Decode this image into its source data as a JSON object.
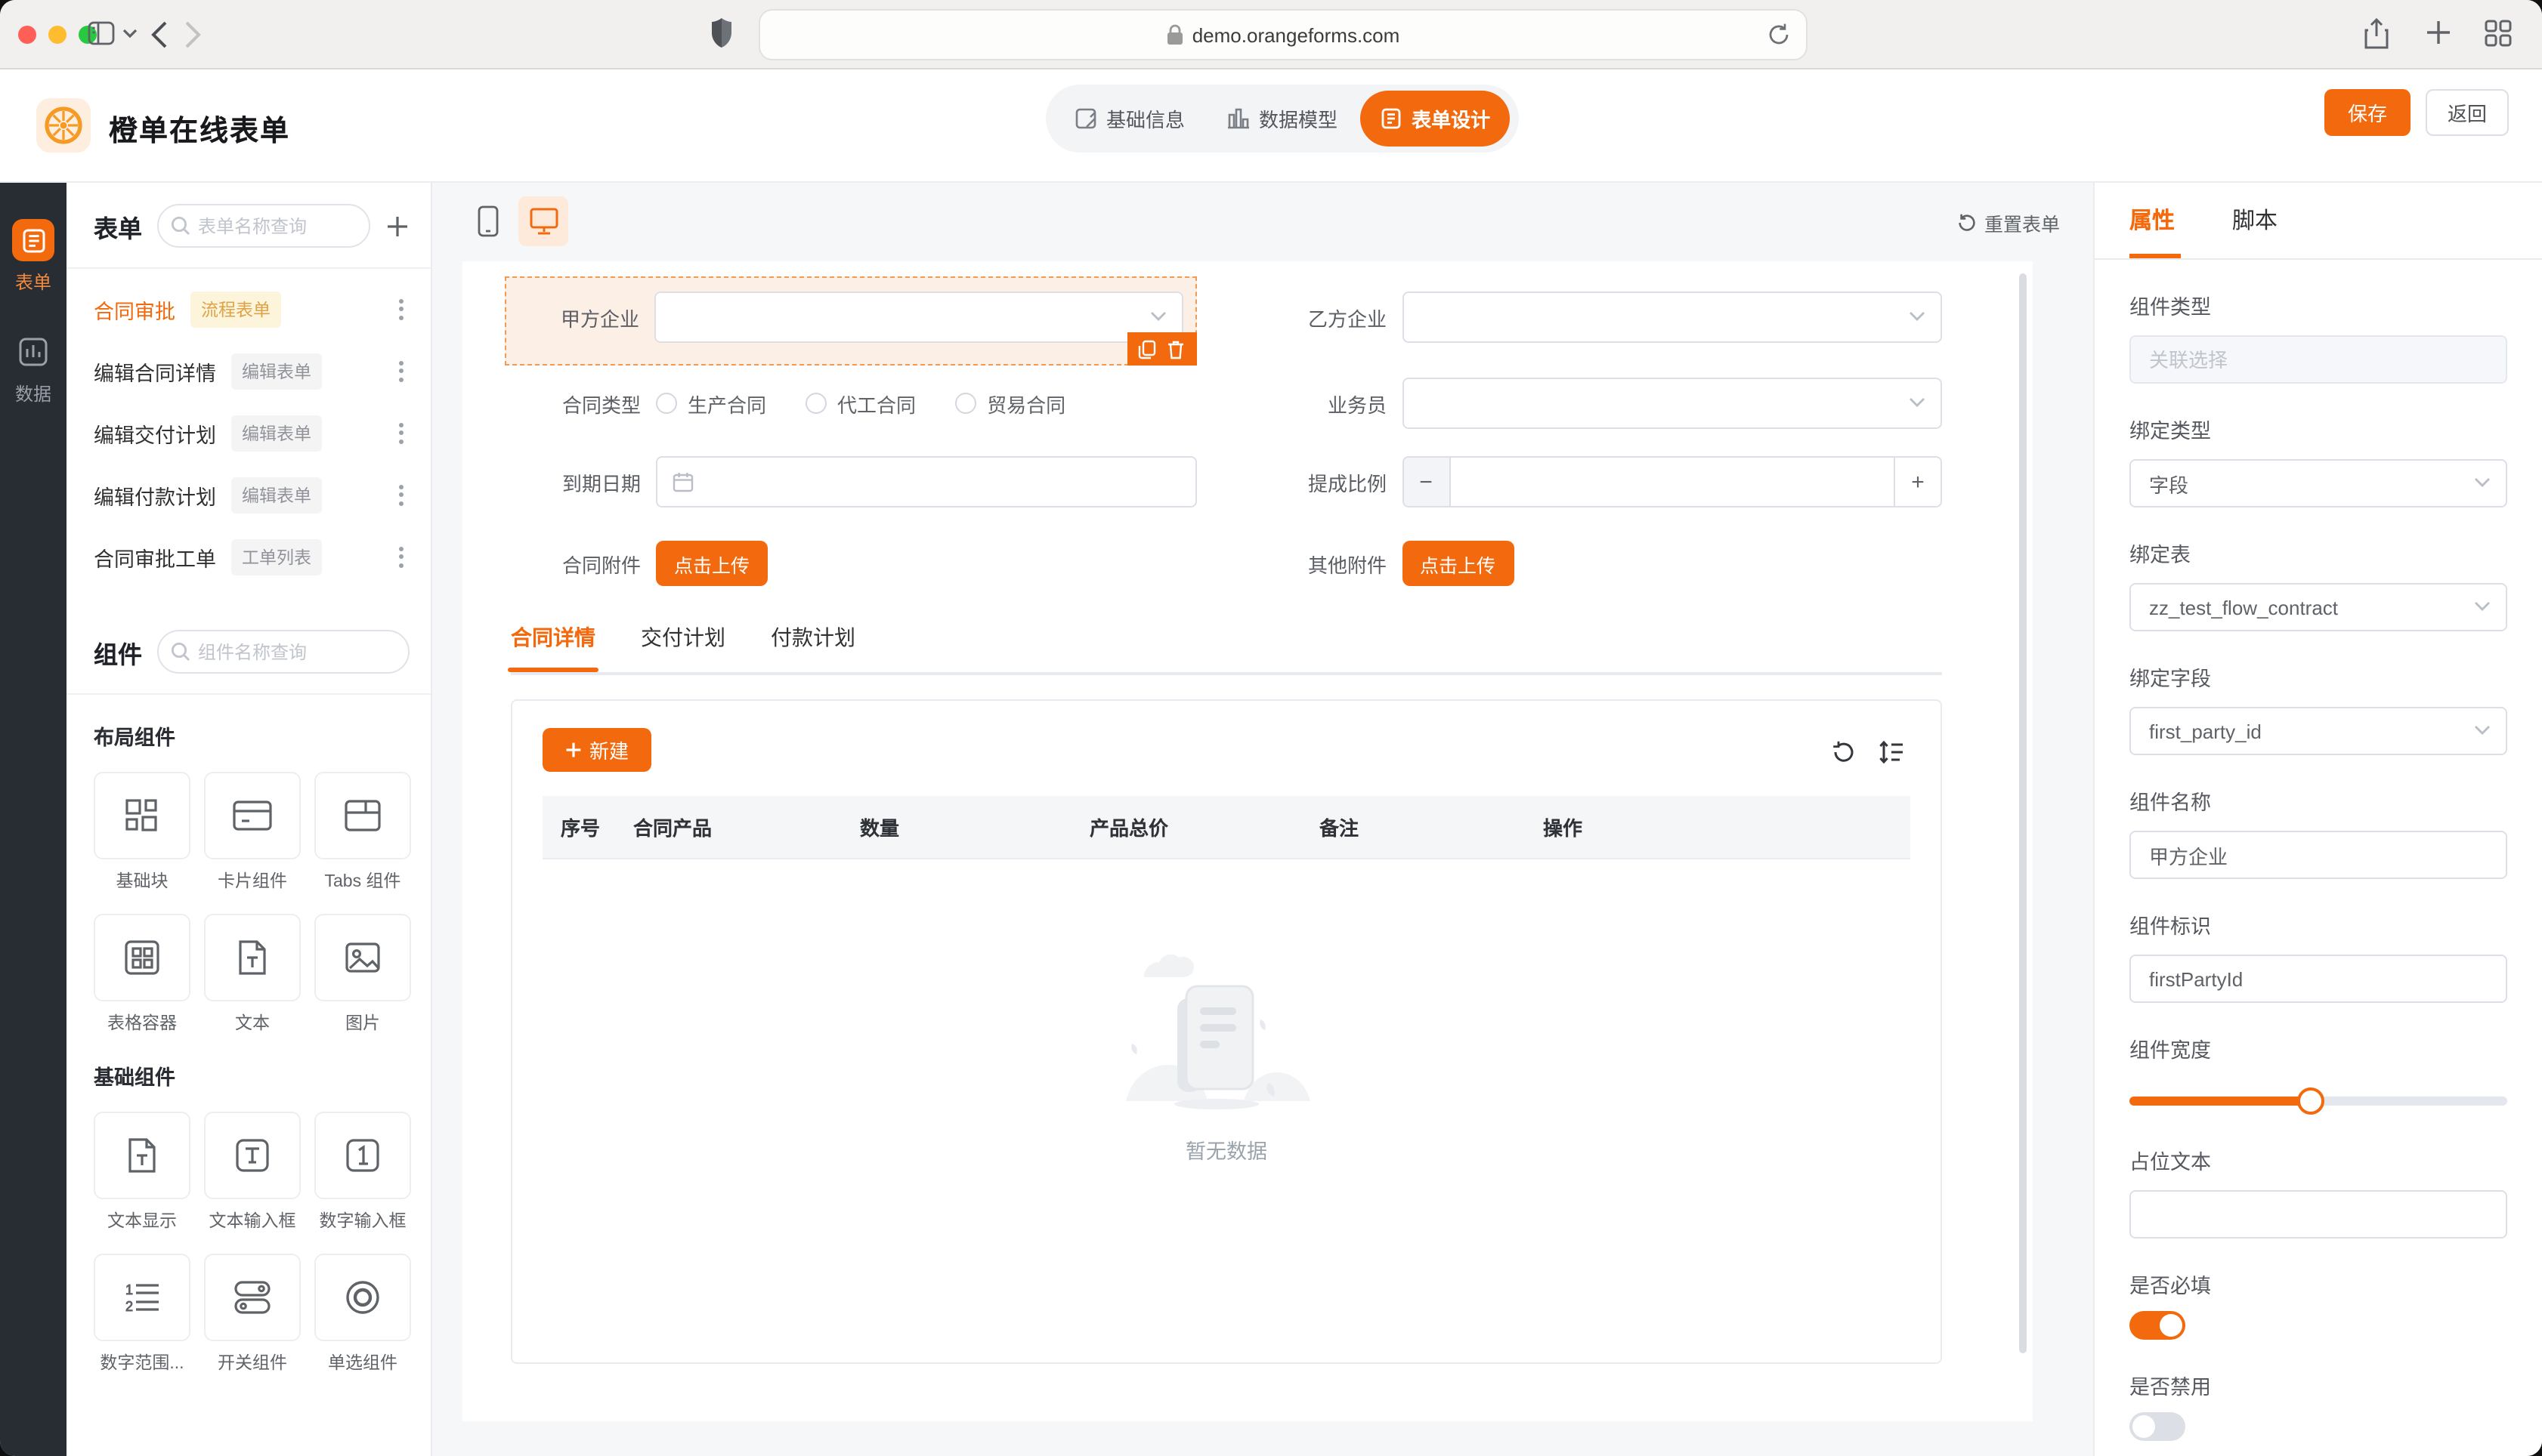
{
  "browser": {
    "url": "demo.orangeforms.com"
  },
  "header": {
    "title": "橙单在线表单",
    "nav_tabs": [
      {
        "label": "基础信息"
      },
      {
        "label": "数据模型"
      },
      {
        "label": "表单设计"
      }
    ],
    "active_nav_tab": "表单设计",
    "save_label": "保存",
    "back_label": "返回"
  },
  "rail": {
    "items": [
      {
        "label": "表单"
      },
      {
        "label": "数据"
      }
    ]
  },
  "forms_panel": {
    "title": "表单",
    "search_placeholder": "表单名称查询",
    "items": [
      {
        "name": "合同审批",
        "badge": "流程表单"
      },
      {
        "name": "编辑合同详情",
        "badge": "编辑表单"
      },
      {
        "name": "编辑交付计划",
        "badge": "编辑表单"
      },
      {
        "name": "编辑付款计划",
        "badge": "编辑表单"
      },
      {
        "name": "合同审批工单",
        "badge": "工单列表"
      }
    ]
  },
  "components_panel": {
    "title": "组件",
    "search_placeholder": "组件名称查询",
    "groups": [
      {
        "label": "布局组件",
        "items": [
          "基础块",
          "卡片组件",
          "Tabs 组件",
          "表格容器",
          "文本",
          "图片"
        ]
      },
      {
        "label": "基础组件",
        "items": [
          "文本显示",
          "文本输入框",
          "数字输入框",
          "数字范围...",
          "开关组件",
          "单选组件"
        ]
      }
    ]
  },
  "canvas": {
    "reset_label": "重置表单",
    "fields": {
      "first_party": {
        "label": "甲方企业"
      },
      "second_party": {
        "label": "乙方企业"
      },
      "contract_type": {
        "label": "合同类型",
        "options": [
          "生产合同",
          "代工合同",
          "贸易合同"
        ]
      },
      "salesman": {
        "label": "业务员"
      },
      "due_date": {
        "label": "到期日期"
      },
      "commission": {
        "label": "提成比例"
      },
      "contract_attachment": {
        "label": "合同附件",
        "button": "点击上传"
      },
      "other_attachment": {
        "label": "其他附件",
        "button": "点击上传"
      }
    },
    "detail_tabs": [
      "合同详情",
      "交付计划",
      "付款计划"
    ],
    "active_detail_tab": "合同详情",
    "table": {
      "new_button": "新建",
      "columns": [
        "序号",
        "合同产品",
        "数量",
        "产品总价",
        "备注",
        "操作"
      ],
      "empty_text": "暂无数据"
    }
  },
  "props_panel": {
    "tabs": [
      "属性",
      "脚本"
    ],
    "active_tab": "属性",
    "fields": {
      "component_type": {
        "label": "组件类型",
        "placeholder": "关联选择"
      },
      "bind_type": {
        "label": "绑定类型",
        "value": "字段"
      },
      "bind_table": {
        "label": "绑定表",
        "value": "zz_test_flow_contract"
      },
      "bind_field": {
        "label": "绑定字段",
        "value": "first_party_id"
      },
      "component_name": {
        "label": "组件名称",
        "value": "甲方企业"
      },
      "component_key": {
        "label": "组件标识",
        "value": "firstPartyId"
      },
      "component_width": {
        "label": "组件宽度",
        "percent": 48
      },
      "placeholder_text": {
        "label": "占位文本",
        "value": ""
      },
      "required": {
        "label": "是否必填",
        "on": true
      },
      "disabled": {
        "label": "是否禁用",
        "on": false
      }
    }
  },
  "colors": {
    "primary": "#f26a0d",
    "selection_bg": "#fcefe5",
    "rail_bg": "#282c33"
  }
}
